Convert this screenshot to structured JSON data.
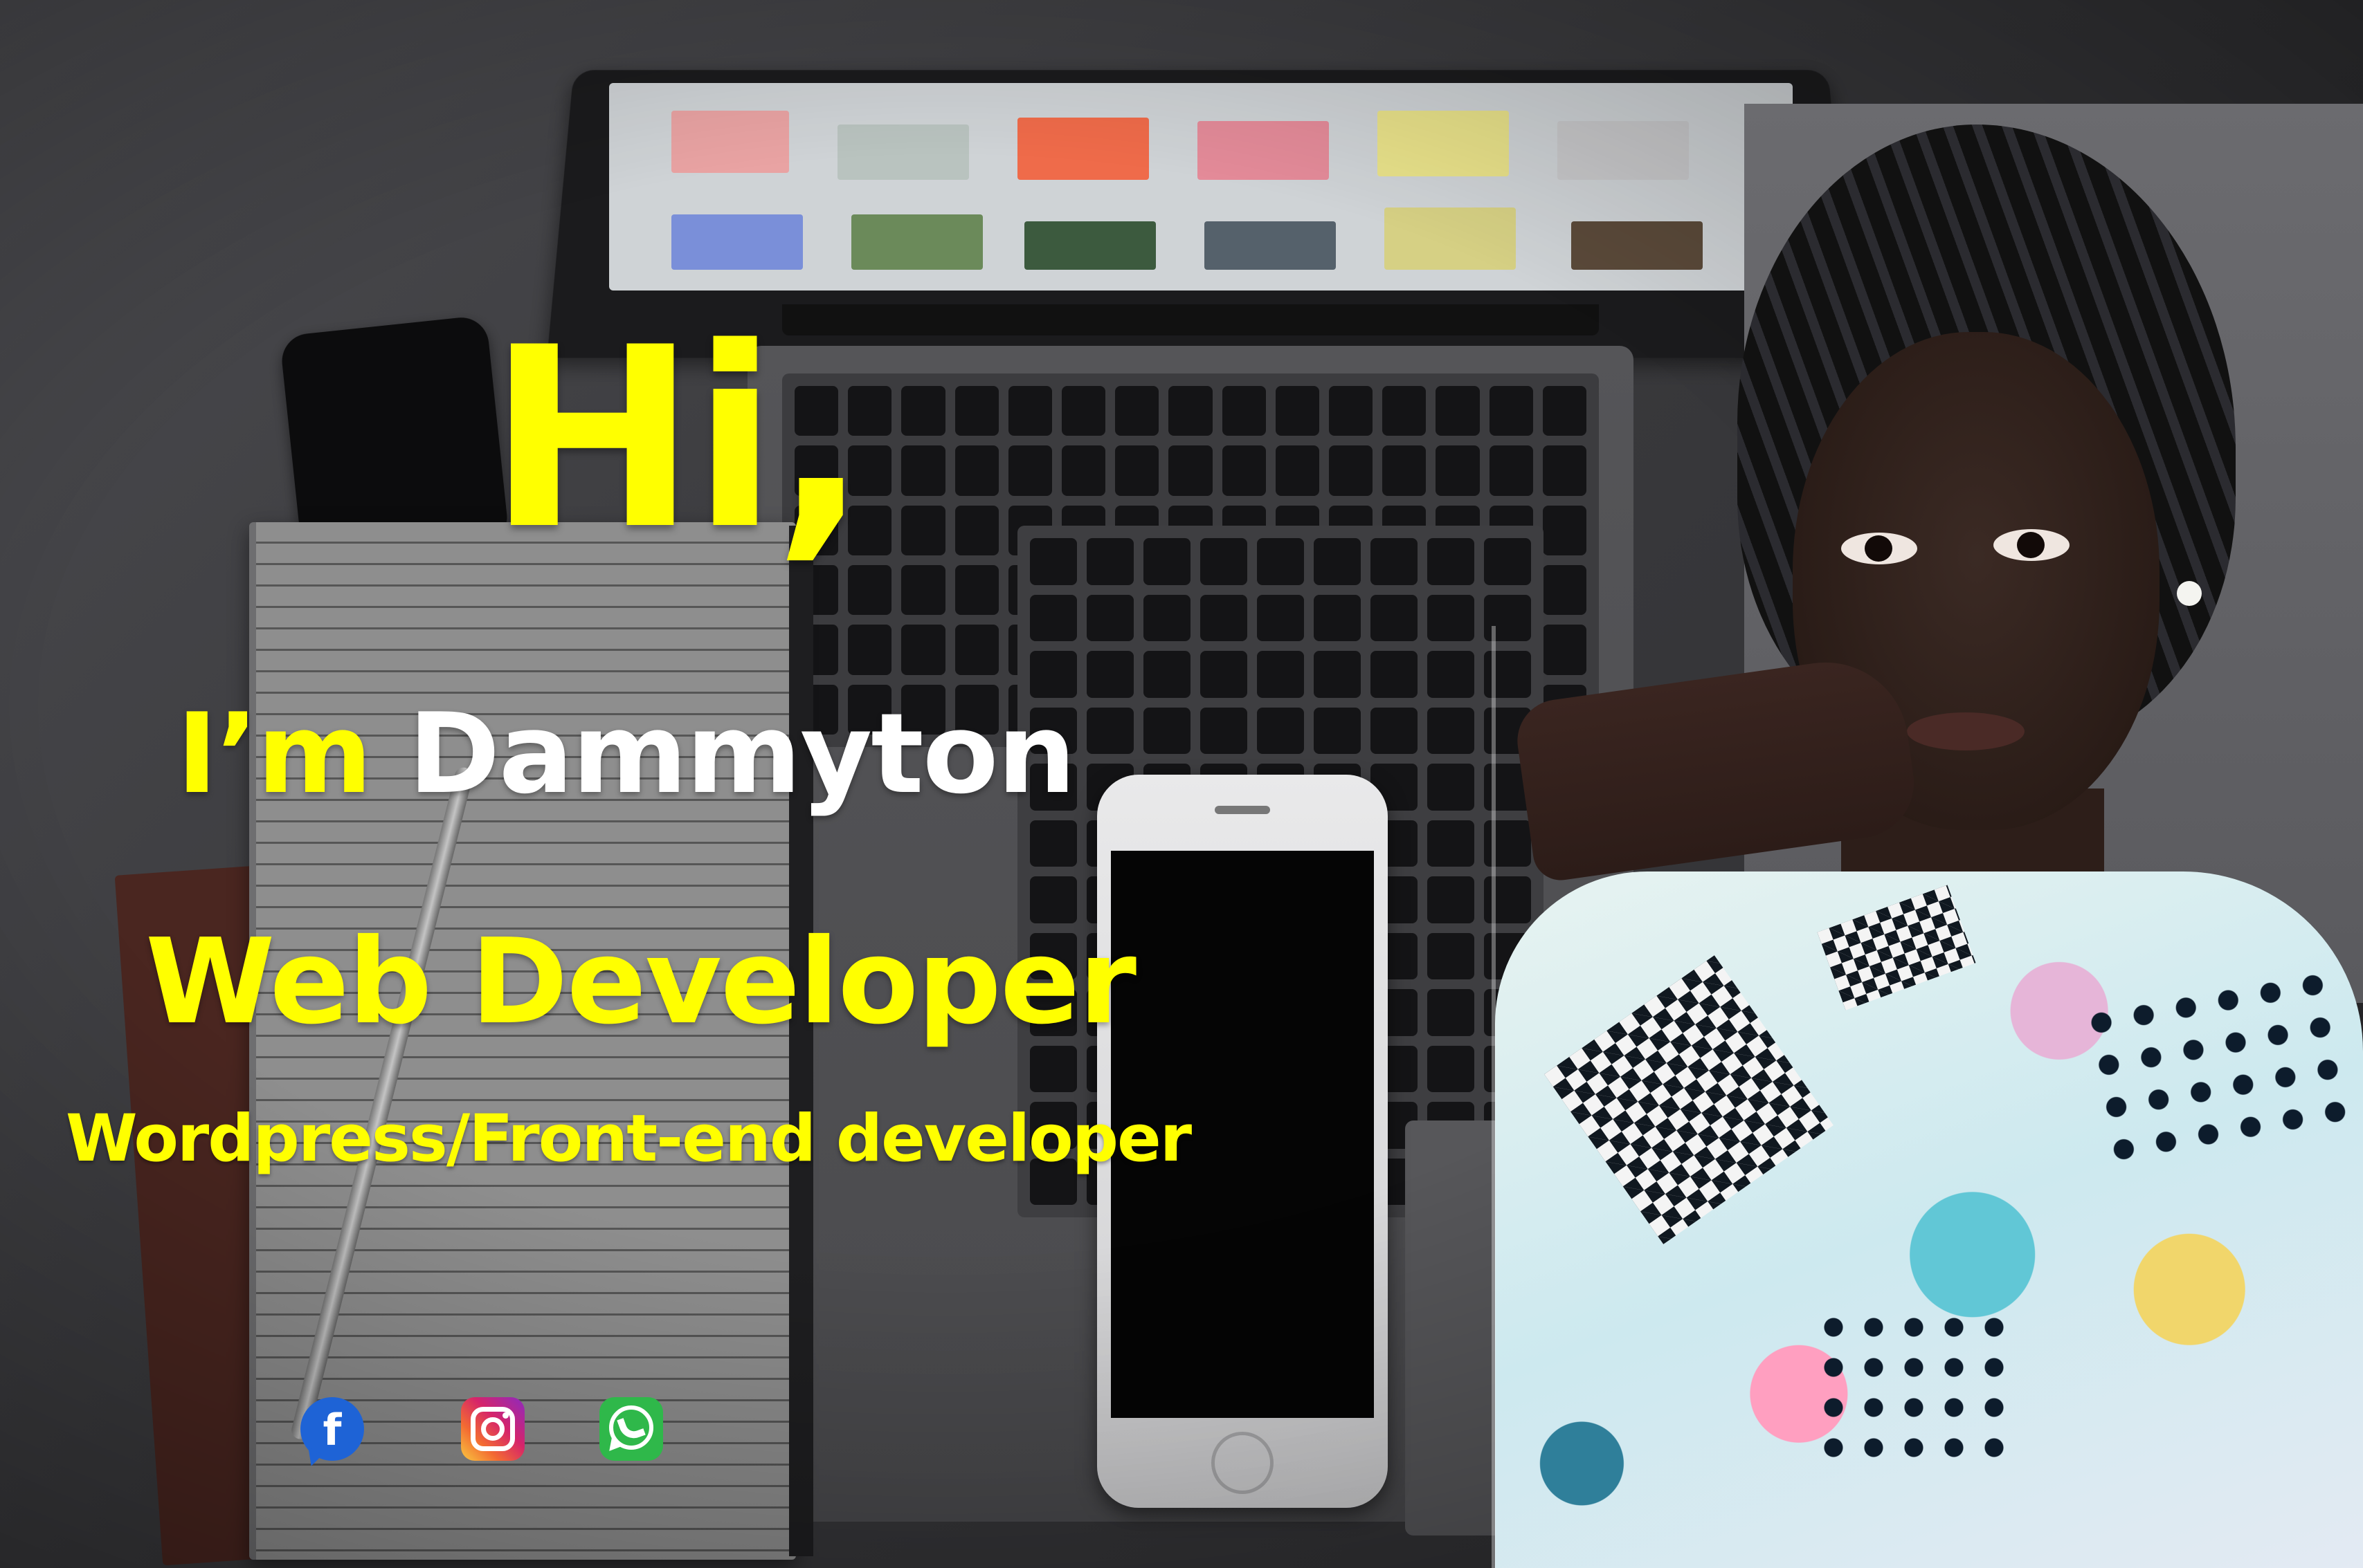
{
  "banner": {
    "greeting": "Hi,",
    "intro_prefix": "I’m ",
    "name": "Dammyton",
    "role": "Web Developer",
    "specialty": "Wordpress/Front-end developer"
  },
  "social": {
    "facebook_letter": "f",
    "icons": [
      "facebook-icon",
      "instagram-icon",
      "whatsapp-icon"
    ]
  },
  "colors": {
    "headline": "#ffff00",
    "name": "#ffffff",
    "facebook": "#1e63d6",
    "whatsapp": "#2fb84a"
  }
}
